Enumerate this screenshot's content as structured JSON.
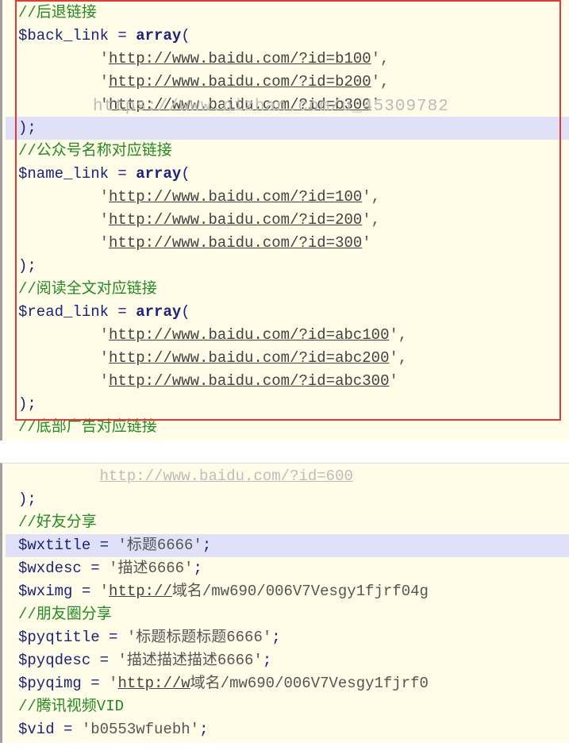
{
  "block1": {
    "lines": [
      {
        "type": "comment",
        "text": "//后退链接"
      },
      {
        "type": "assign",
        "var": "$back_link",
        "eq": " = ",
        "kw": "array",
        "tail": "("
      },
      {
        "type": "arritem",
        "indent": "         ",
        "q": "'",
        "url": "http://www.baidu.com/?id=b100",
        "q2": "',",
        "highlight": false
      },
      {
        "type": "arritem",
        "indent": "         ",
        "q": "'",
        "url": "http://www.baidu.com/?id=b200",
        "q2": "',",
        "highlight": false
      },
      {
        "type": "arritem",
        "indent": "         ",
        "q": "'",
        "url": "http://www.baidu.com/?id=b300",
        "q2": "'",
        "highlight": false,
        "watermark": "https://www.nizhan.com/u_45309782"
      },
      {
        "type": "close",
        "text": ");",
        "highlight": true
      },
      {
        "type": "comment",
        "text": "//公众号名称对应链接"
      },
      {
        "type": "assign",
        "var": "$name_link",
        "eq": " = ",
        "kw": "array",
        "tail": "("
      },
      {
        "type": "arritem",
        "indent": "         ",
        "q": "'",
        "url": "http://www.baidu.com/?id=100",
        "q2": "',",
        "highlight": false
      },
      {
        "type": "arritem",
        "indent": "         ",
        "q": "'",
        "url": "http://www.baidu.com/?id=200",
        "q2": "',",
        "highlight": false
      },
      {
        "type": "arritem",
        "indent": "         ",
        "q": "'",
        "url": "http://www.baidu.com/?id=300",
        "q2": "'",
        "highlight": false
      },
      {
        "type": "close",
        "text": ");",
        "highlight": false
      },
      {
        "type": "comment",
        "text": "//阅读全文对应链接"
      },
      {
        "type": "assign",
        "var": "$read_link",
        "eq": " = ",
        "kw": "array",
        "tail": "("
      },
      {
        "type": "arritem",
        "indent": "         ",
        "q": "'",
        "url": "http://www.baidu.com/?id=abc100",
        "q2": "',",
        "highlight": false
      },
      {
        "type": "arritem",
        "indent": "         ",
        "q": "'",
        "url": "http://www.baidu.com/?id=abc200",
        "q2": "',",
        "highlight": false
      },
      {
        "type": "arritem",
        "indent": "         ",
        "q": "'",
        "url": "http://www.baidu.com/?id=abc300",
        "q2": "'",
        "highlight": false
      },
      {
        "type": "close",
        "text": ");",
        "highlight": false
      },
      {
        "type": "comment",
        "text": "//底部广告对应链接"
      }
    ]
  },
  "block2": {
    "lines": [
      {
        "type": "arritem_dim",
        "indent": "         ",
        "url": "http://www.baidu.com/?id=600"
      },
      {
        "type": "close",
        "text": ");",
        "highlight": false
      },
      {
        "type": "comment",
        "text": "//好友分享"
      },
      {
        "type": "assign2",
        "var": "$wxtitle",
        "eq": " = ",
        "str": "'标题6666'",
        "semi": ";",
        "highlight": true
      },
      {
        "type": "assign2",
        "var": "$wxdesc",
        "eq": " = ",
        "str": "'描述6666'",
        "semi": ";"
      },
      {
        "type": "assign2url",
        "var": "$wximg",
        "eq": " = ",
        "q": "'",
        "url": "http://",
        "tail": "域名/mw690/006V7Vesgy1fjrf04g"
      },
      {
        "type": "comment",
        "text": "//朋友圈分享"
      },
      {
        "type": "assign2",
        "var": "$pyqtitle",
        "eq": " = ",
        "str": "'标题标题标题6666'",
        "semi": ";"
      },
      {
        "type": "assign2",
        "var": "$pyqdesc",
        "eq": " = ",
        "str": "'描述描述描述6666'",
        "semi": ";"
      },
      {
        "type": "assign2url",
        "var": "$pyqimg",
        "eq": " = ",
        "q": "'",
        "url": "http://w",
        "tail": "域名/mw690/006V7Vesgy1fjrf0"
      },
      {
        "type": "comment",
        "text": "//腾讯视频VID"
      },
      {
        "type": "assign2",
        "var": "$vid",
        "eq": " = ",
        "str": "'b0553wfuebh'",
        "semi": ";"
      }
    ]
  }
}
